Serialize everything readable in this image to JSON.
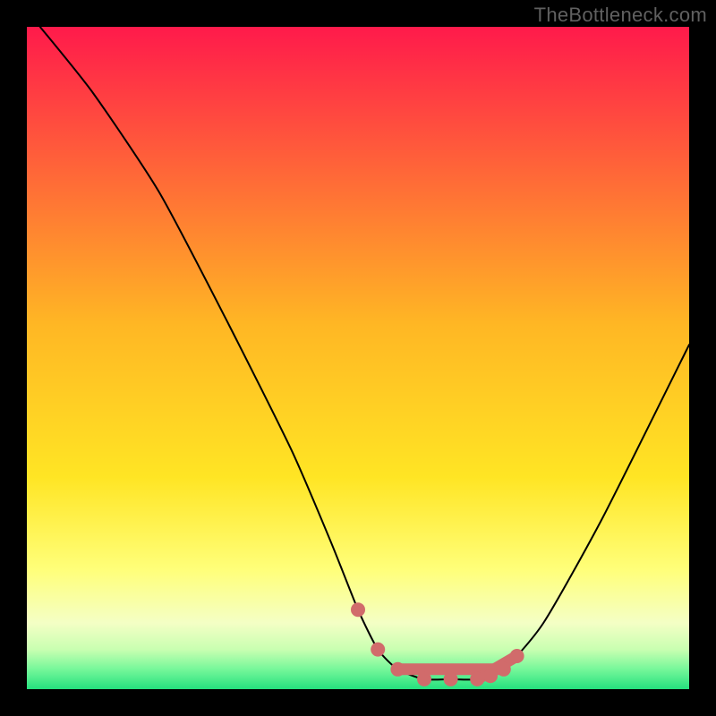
{
  "watermark": "TheBottleneck.com",
  "chart_data": {
    "type": "line",
    "title": "",
    "xlabel": "",
    "ylabel": "",
    "xlim": [
      0,
      100
    ],
    "ylim": [
      0,
      100
    ],
    "grid": false,
    "background_gradient": {
      "stops": [
        {
          "offset": 0.0,
          "color": "#ff1a4b"
        },
        {
          "offset": 0.45,
          "color": "#ffb724"
        },
        {
          "offset": 0.68,
          "color": "#ffe524"
        },
        {
          "offset": 0.82,
          "color": "#ffff7a"
        },
        {
          "offset": 0.9,
          "color": "#f4ffc5"
        },
        {
          "offset": 0.94,
          "color": "#c9ffb1"
        },
        {
          "offset": 0.97,
          "color": "#76f79a"
        },
        {
          "offset": 1.0,
          "color": "#25e07e"
        }
      ]
    },
    "series": [
      {
        "name": "bottleneck-curve",
        "x": [
          2,
          10,
          20,
          30,
          40,
          46,
          50,
          53,
          56,
          60,
          64,
          68,
          72,
          78,
          87,
          100
        ],
        "y": [
          100,
          90,
          75,
          56,
          36,
          22,
          12,
          6,
          3,
          1.5,
          1.5,
          1.5,
          3,
          10,
          26,
          52
        ],
        "color": "#000000",
        "width": 2
      }
    ],
    "markers": {
      "name": "optimal-range",
      "color": "#d16b6b",
      "points": [
        {
          "x": 50,
          "y": 12
        },
        {
          "x": 53,
          "y": 6
        },
        {
          "x": 56,
          "y": 3
        },
        {
          "x": 60,
          "y": 1.5
        },
        {
          "x": 64,
          "y": 1.5
        },
        {
          "x": 68,
          "y": 1.5
        },
        {
          "x": 70,
          "y": 2
        },
        {
          "x": 72,
          "y": 3
        },
        {
          "x": 74,
          "y": 5
        }
      ],
      "segments": [
        {
          "x1": 56,
          "y1": 3,
          "x2": 72,
          "y2": 3
        },
        {
          "x1": 68,
          "y1": 1.5,
          "x2": 74,
          "y2": 5
        }
      ]
    }
  }
}
